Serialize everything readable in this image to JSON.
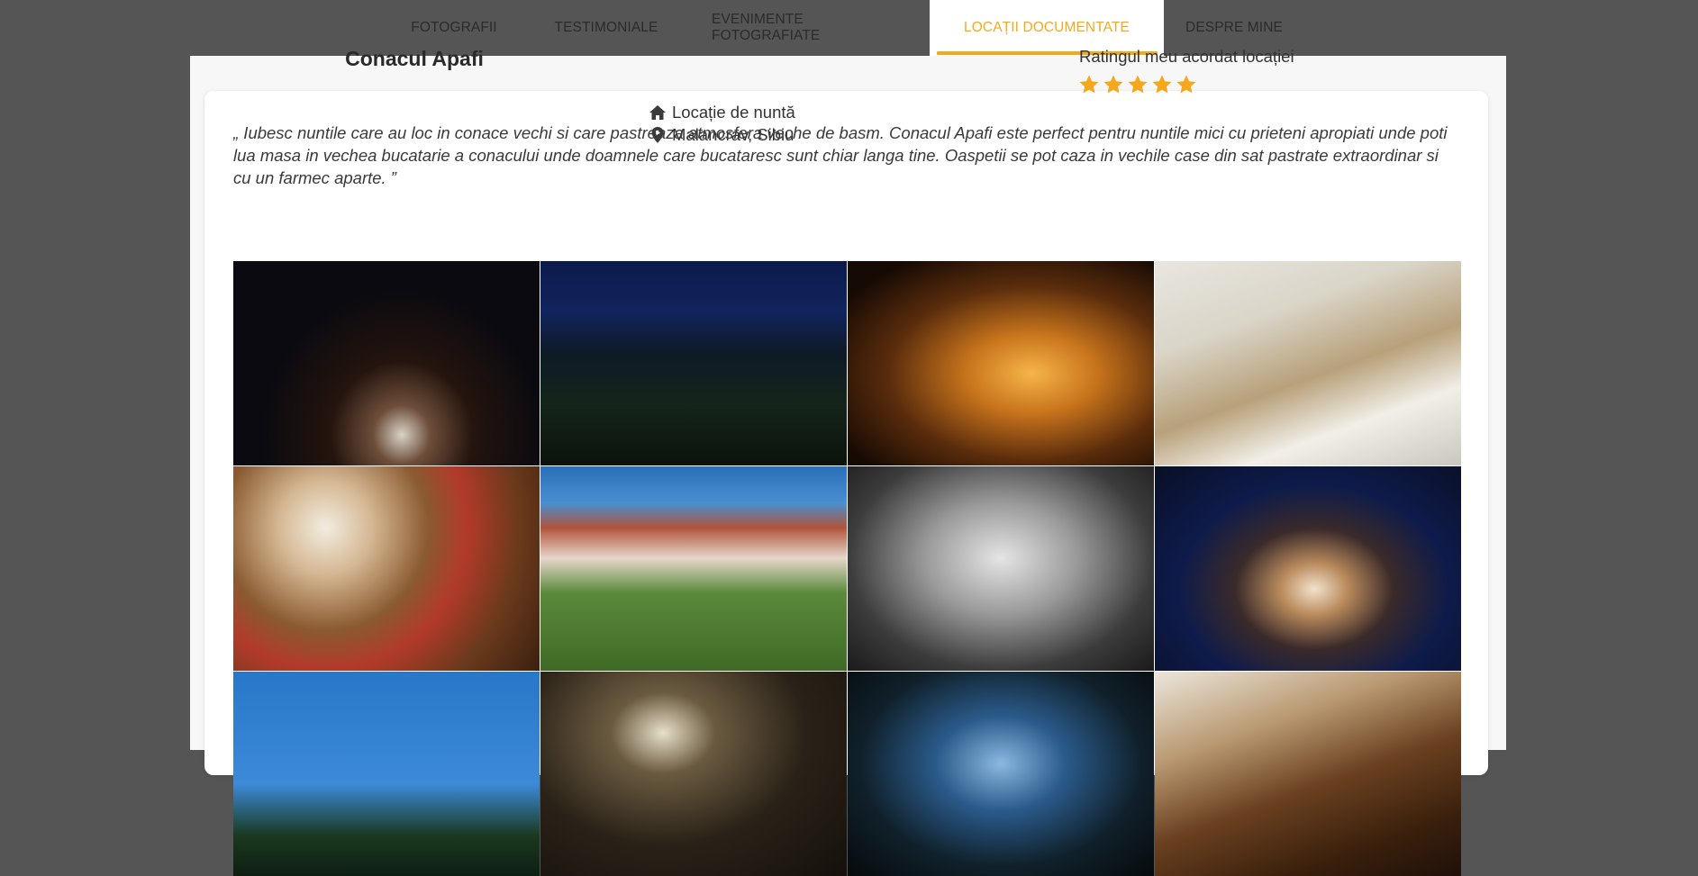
{
  "nav": {
    "tabs": [
      {
        "label": "FOTOGRAFII",
        "active": false
      },
      {
        "label": "TESTIMONIALE",
        "active": false
      },
      {
        "label": "EVENIMENTE FOTOGRAFIATE",
        "active": false
      },
      {
        "label": "LOCAȚII DOCUMENTATE",
        "active": true
      },
      {
        "label": "DESPRE MINE",
        "active": false
      }
    ]
  },
  "location": {
    "name": "Conacul Apafi",
    "type_label": "Locație de nuntă",
    "place": "Malancrav, Sibiu",
    "type_icon": "home-icon",
    "place_icon": "map-pin-icon",
    "rating_label": "Ratingul meu acordat locației",
    "rating": 5,
    "rating_max": 5,
    "quote": "„ Iubesc nuntile care au loc in conace vechi si care pastreaza atmosfera veche de basm. Conacul Apafi este perfect pentru nuntile mici cu prieteni apropiati unde poti lua masa in vechea bucatarie a conacului unde doamnele care bucataresc sunt chiar langa tine. Oaspetii se pot caza in vechile case din sat pastrate extraordinar si cu un farmec aparte. ”"
  },
  "colors": {
    "accent": "#f2a91e",
    "background": "#555555",
    "star": "#f5a81c"
  }
}
